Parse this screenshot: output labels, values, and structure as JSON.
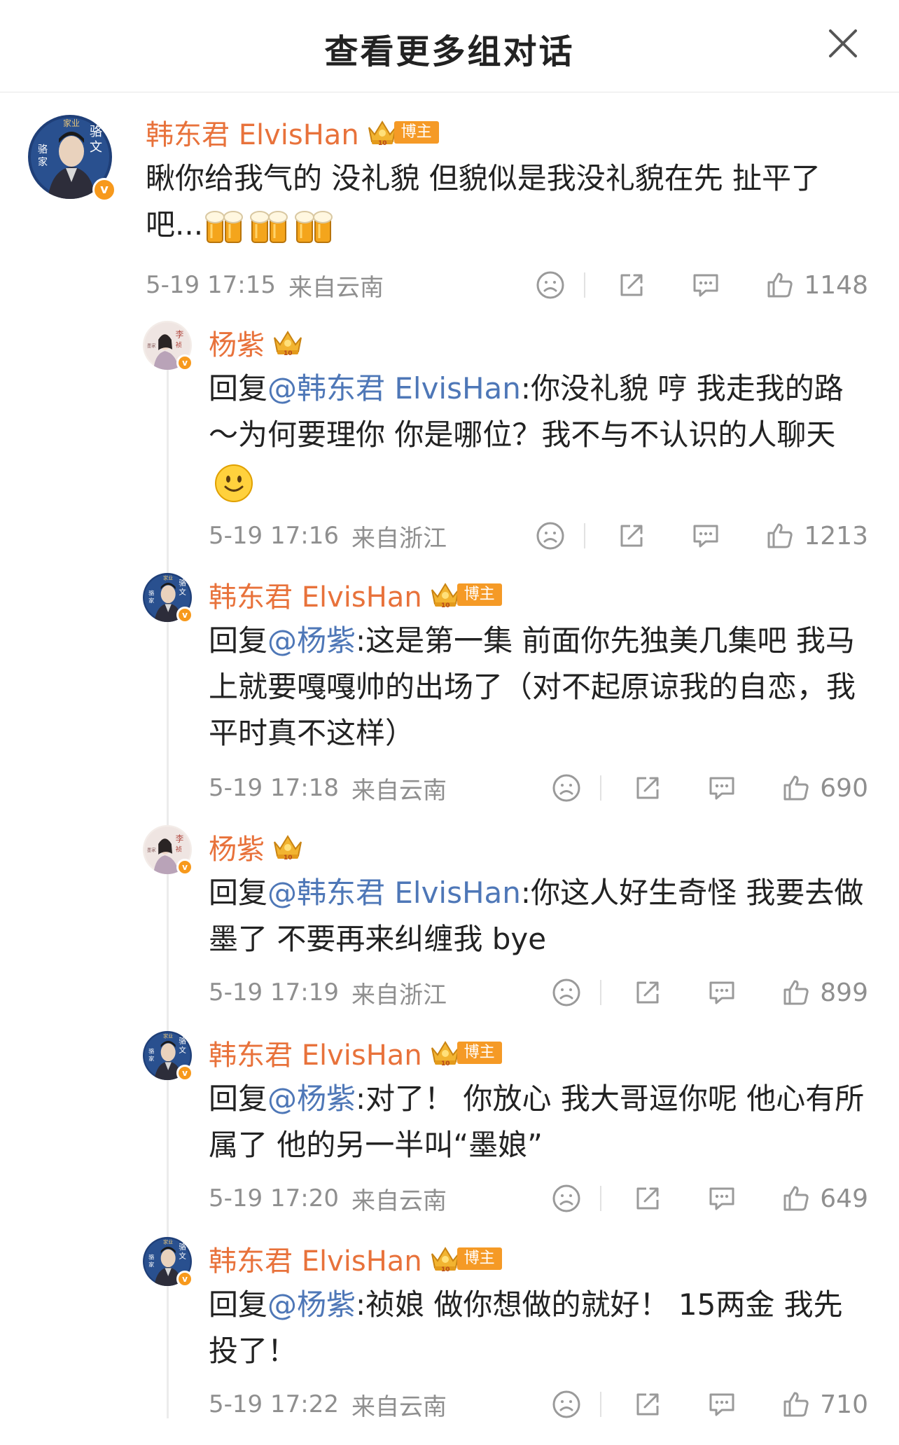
{
  "header": {
    "title": "查看更多组对话"
  },
  "colors": {
    "accent_name": "#e8723b",
    "mention": "#4e77b7",
    "meta_gray": "#8f8f8f",
    "vip_orange": "#f7991c"
  },
  "comments": [
    {
      "user": "韩东君 ElvisHan",
      "badge": "博主",
      "text": "瞅你给我气的  没礼貌   但貌似是我没礼貌在先    扯平了吧...",
      "time": "5-19 17:15",
      "location": "来自云南",
      "likes": "1148"
    },
    {
      "user": "杨紫",
      "reply_prefix": "回复",
      "mention": "@韩东君 ElvisHan",
      "text": ":你没礼貌 哼 我走我的路～为何要理你 你是哪位？我不与不认识的人聊天",
      "time": "5-19 17:16",
      "location": "来自浙江",
      "likes": "1213"
    },
    {
      "user": "韩东君 ElvisHan",
      "badge": "博主",
      "reply_prefix": "回复",
      "mention": "@杨紫",
      "text": ":这是第一集  前面你先独美几集吧  我马上就要嘎嘎帅的出场了（对不起原谅我的自恋，我平时真不这样）",
      "time": "5-19 17:18",
      "location": "来自云南",
      "likes": "690"
    },
    {
      "user": "杨紫",
      "reply_prefix": "回复",
      "mention": "@韩东君 ElvisHan",
      "text": ":你这人好生奇怪 我要去做墨了 不要再来纠缠我 bye",
      "time": "5-19 17:19",
      "location": "来自浙江",
      "likes": "899"
    },
    {
      "user": "韩东君 ElvisHan",
      "badge": "博主",
      "reply_prefix": "回复",
      "mention": "@杨紫",
      "text": ":对了！ 你放心 我大哥逗你呢  他心有所属了  他的另一半叫“墨娘”",
      "time": "5-19 17:20",
      "location": "来自云南",
      "likes": "649"
    },
    {
      "user": "韩东君 ElvisHan",
      "badge": "博主",
      "reply_prefix": "回复",
      "mention": "@杨紫",
      "text": ":祯娘  做你想做的就好！ 15两金 我先投了！",
      "time": "5-19 17:22",
      "location": "来自云南",
      "likes": "710"
    }
  ],
  "icons": {
    "close": "close-icon",
    "dislike": "sad-face-icon",
    "share": "share-icon",
    "comment": "comment-icon",
    "like": "thumbs-up-icon",
    "beer": "beer-mug-emoji",
    "smile": "smile-emoji",
    "crown": "crown-icon",
    "verified": "verified-v-icon"
  }
}
